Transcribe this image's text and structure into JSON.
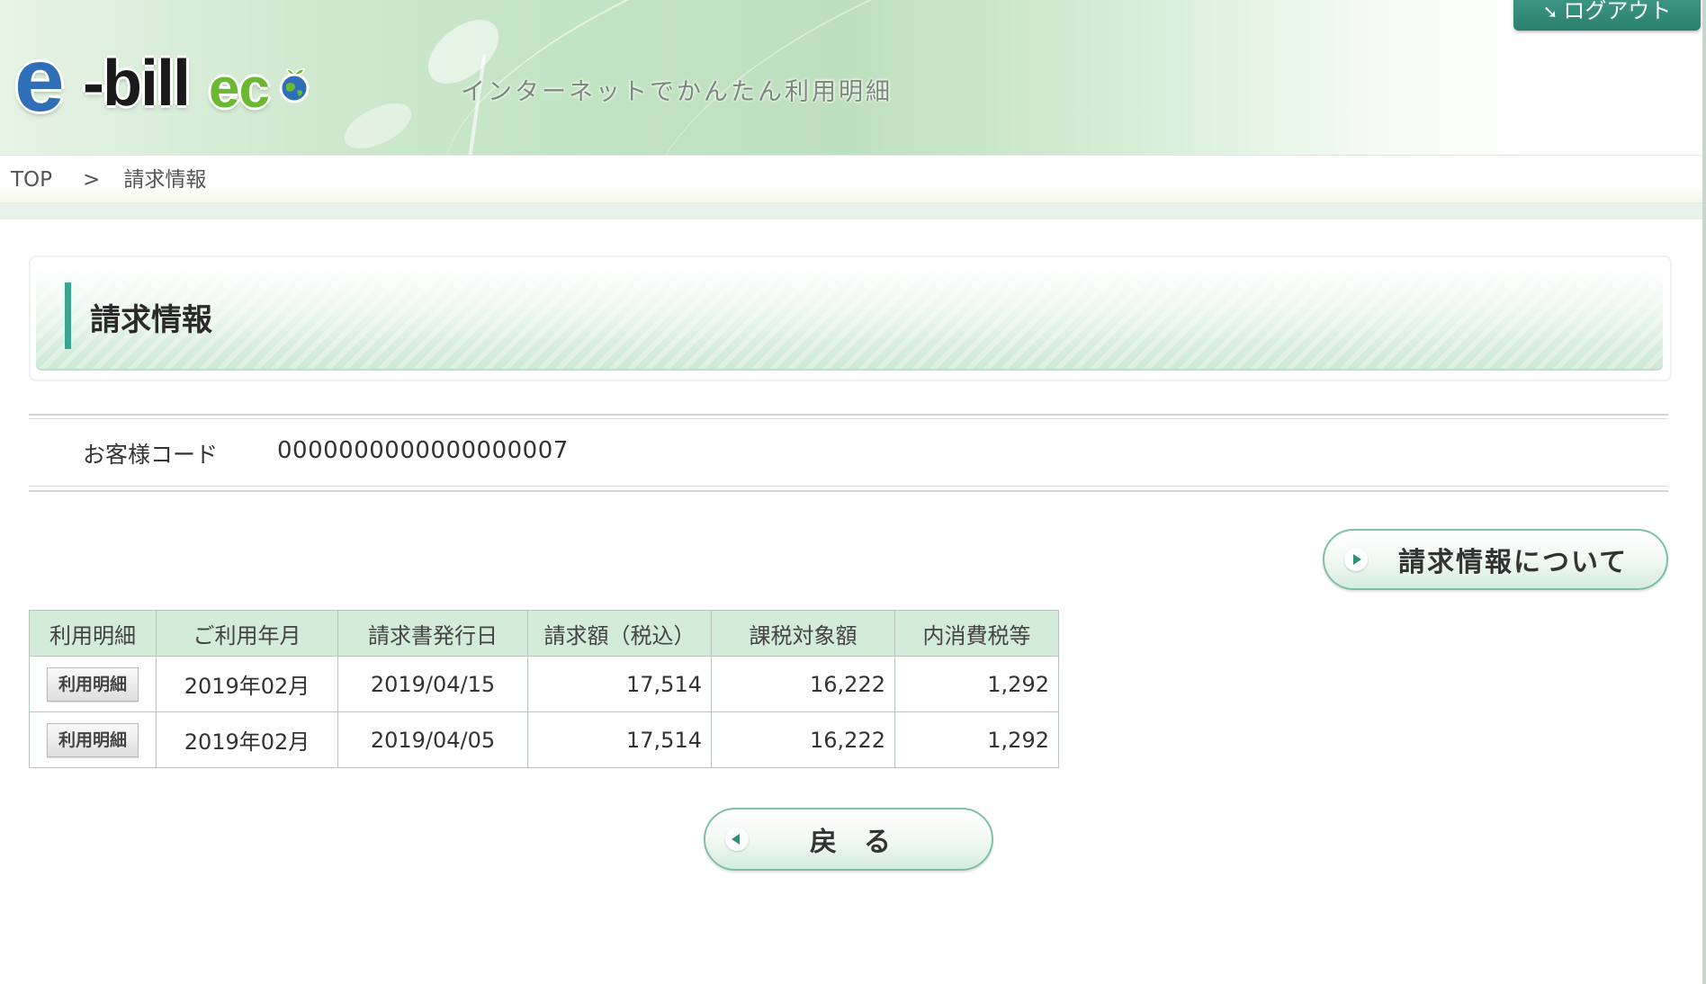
{
  "header": {
    "logo": {
      "e": "e",
      "bill": "-bill",
      "eco": "ec"
    },
    "tagline": "インターネットでかんたん利用明細",
    "logout_label": "ログアウト"
  },
  "breadcrumb": {
    "home": "TOP",
    "separator": ">",
    "current": "請求情報"
  },
  "page_title": "請求情報",
  "customer": {
    "label": "お客様コード",
    "code": "0000000000000000007"
  },
  "about_button_label": "請求情報について",
  "table": {
    "headers": [
      "利用明細",
      "ご利用年月",
      "請求書発行日",
      "請求額（税込）",
      "課税対象額",
      "内消費税等"
    ],
    "rows": [
      {
        "detail_button": "利用明細",
        "month": "2019年02月",
        "issue_date": "2019/04/15",
        "amount": "17,514",
        "taxable": "16,222",
        "tax": "1,292"
      },
      {
        "detail_button": "利用明細",
        "month": "2019年02月",
        "issue_date": "2019/04/05",
        "amount": "17,514",
        "taxable": "16,222",
        "tax": "1,292"
      }
    ]
  },
  "back_button_label": "戻る",
  "colors": {
    "accent": "#3aa58e",
    "logout_bg": "#2b7f6e",
    "table_header": "#d3ebd9"
  }
}
